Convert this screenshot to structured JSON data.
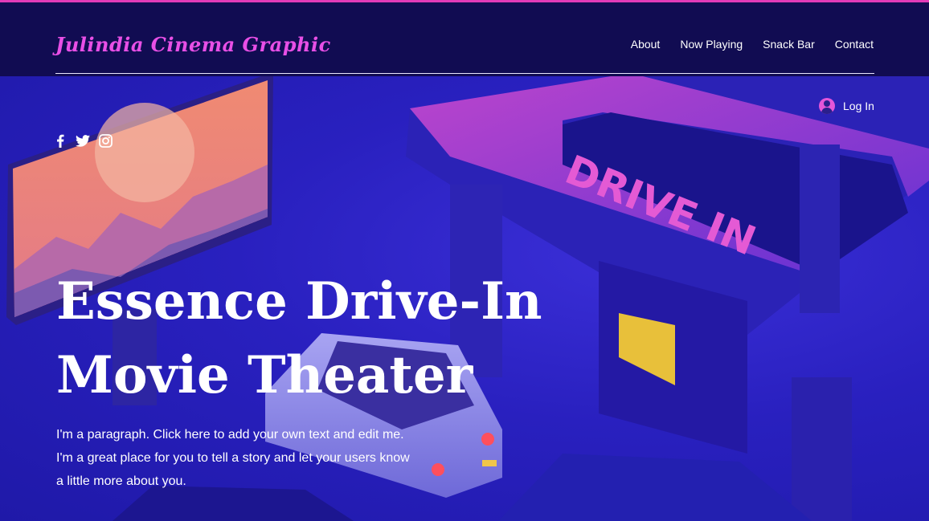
{
  "site": {
    "logo_text": "Julindia Cinema Graphic",
    "accent_color": "#e84fe6",
    "header_bg": "#110c52",
    "hero_color": "#2a23c9"
  },
  "nav": {
    "items": [
      {
        "label": "About"
      },
      {
        "label": "Now Playing"
      },
      {
        "label": "Snack Bar"
      },
      {
        "label": "Contact"
      }
    ]
  },
  "auth": {
    "login_label": "Log In",
    "icon": "user-avatar-icon"
  },
  "social": {
    "icons": [
      "facebook-icon",
      "twitter-icon",
      "instagram-icon"
    ]
  },
  "hero": {
    "title_line1": "Essence Drive-In",
    "title_line2": "Movie Theater",
    "paragraph_line1": "I'm a paragraph. Click here to add your own text and edit me.",
    "paragraph_line2": "I'm a great place for you to tell a story and let your users know",
    "paragraph_line3": "a little more about you.",
    "sign_text": "DRIVE IN"
  }
}
